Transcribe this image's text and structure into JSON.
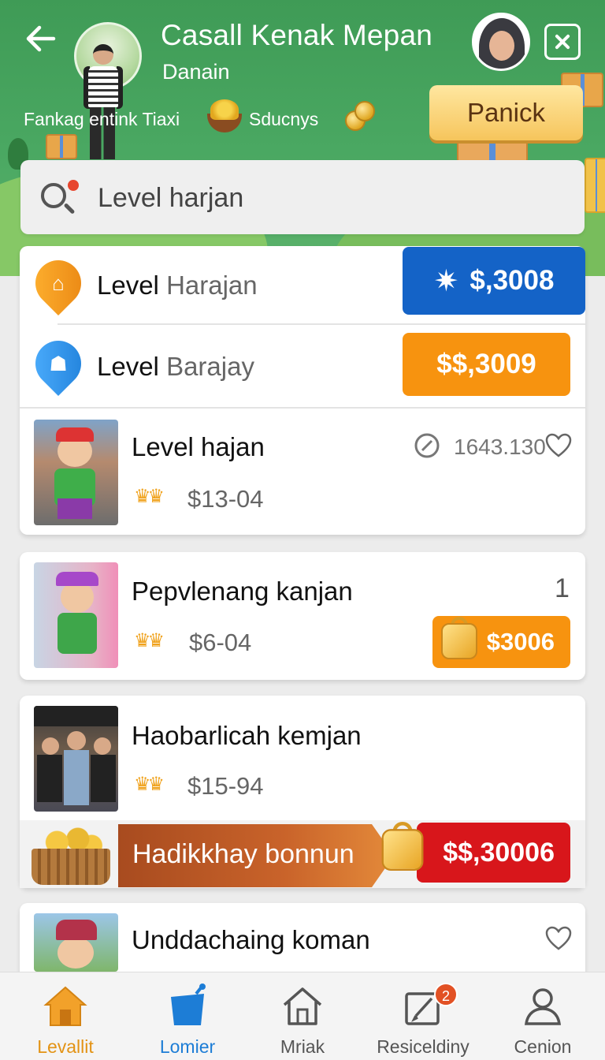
{
  "header": {
    "title": "Casall Kenak Mepan",
    "subtitle": "Danain",
    "info_left": "Fankag entink Tiaxi",
    "info_mid": "Sducnys",
    "panic_button": "Panick"
  },
  "search": {
    "placeholder": "Level harjan"
  },
  "levels": [
    {
      "strong": "Level",
      "muted": "Harajan",
      "price": "$,3008",
      "color": "#1463c7",
      "pin_color": "#f39b1a"
    },
    {
      "strong": "Level",
      "muted": "Barajay",
      "price": "$$,3009",
      "color": "#f7930f",
      "pin_color": "#2e8ee6"
    }
  ],
  "items": [
    {
      "title": "Level hajan",
      "price": "$13-04",
      "meta": "1643.130"
    },
    {
      "title": "Pepvlenang kanjan",
      "price": "$6-04",
      "count": "1",
      "badge_price": "$3006"
    },
    {
      "title": "Haobarlicah kemjan",
      "price": "$15-94"
    },
    {
      "title": "Unddachaing koman"
    }
  ],
  "bonus": {
    "label": "Hadikkhay bonnun",
    "price": "$$,30006"
  },
  "nav": [
    {
      "label": "Levallit",
      "active": true,
      "color": "#e39315"
    },
    {
      "label": "Lomier",
      "active": false,
      "color": "#1d7dd6"
    },
    {
      "label": "Mriak",
      "active": false
    },
    {
      "label": "Resiceldiny",
      "active": false,
      "badge": "2"
    },
    {
      "label": "Cenion",
      "active": false
    }
  ]
}
